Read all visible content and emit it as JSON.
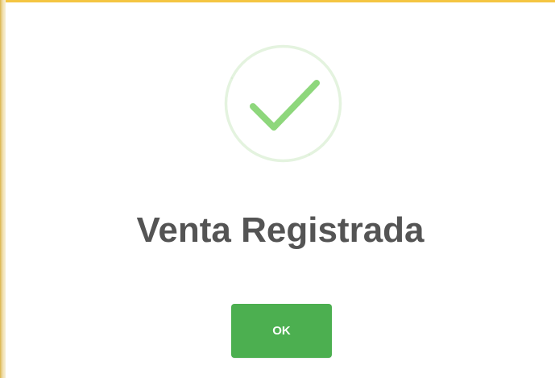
{
  "dialog": {
    "icon": "success-check-icon",
    "title": "Venta Registrada",
    "ok_label": "OK"
  },
  "colors": {
    "success_green": "#4caf50",
    "check_green": "#8ed77c",
    "ring_green": "#e4f3df",
    "title_text": "#545454",
    "window_accent": "#f4c542"
  }
}
